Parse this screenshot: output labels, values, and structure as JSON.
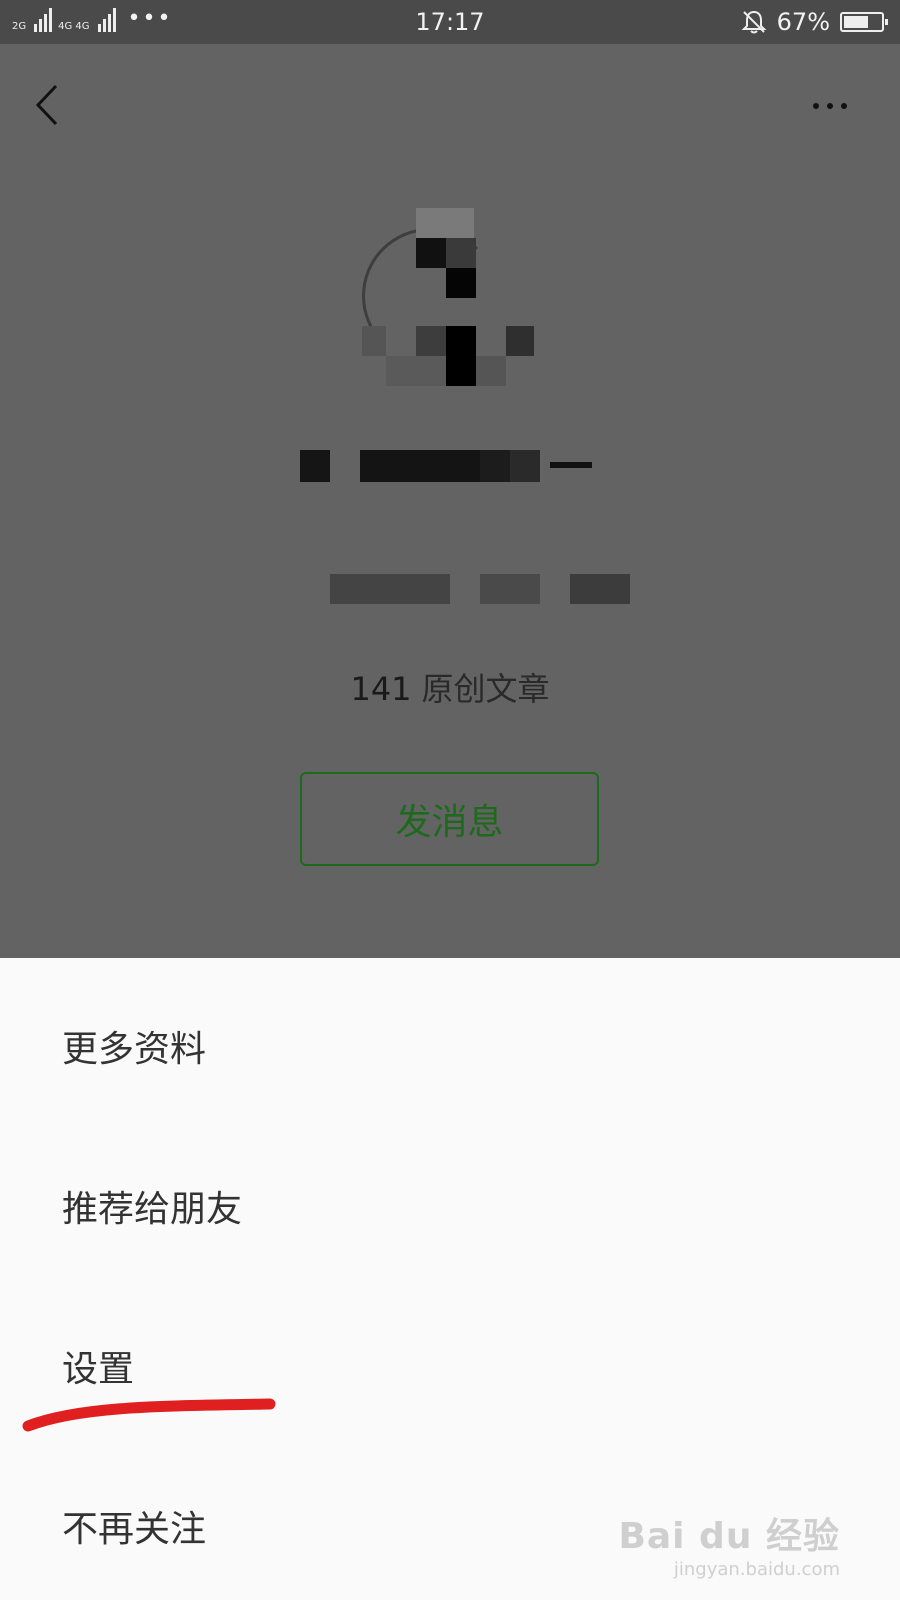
{
  "status_bar": {
    "signal1_label": "2G",
    "signal2_label": "4G 4G",
    "more_dots": "•••",
    "time": "17:17",
    "battery_percent": "67%",
    "battery_level": 0.67
  },
  "profile": {
    "article_count": "141",
    "article_label": "原创文章",
    "message_button": "发消息"
  },
  "menu": {
    "items": [
      "更多资料",
      "推荐给朋友",
      "设置",
      "不再关注"
    ]
  },
  "watermark": {
    "brand": "Bai du 经验",
    "url": "jingyan.baidu.com"
  },
  "colors": {
    "overlay": "#646364",
    "status_bar": "#4a4a4a",
    "sheet": "#fafafb",
    "accent_green": "#1c6b1c",
    "annotation_red": "#e02020"
  }
}
